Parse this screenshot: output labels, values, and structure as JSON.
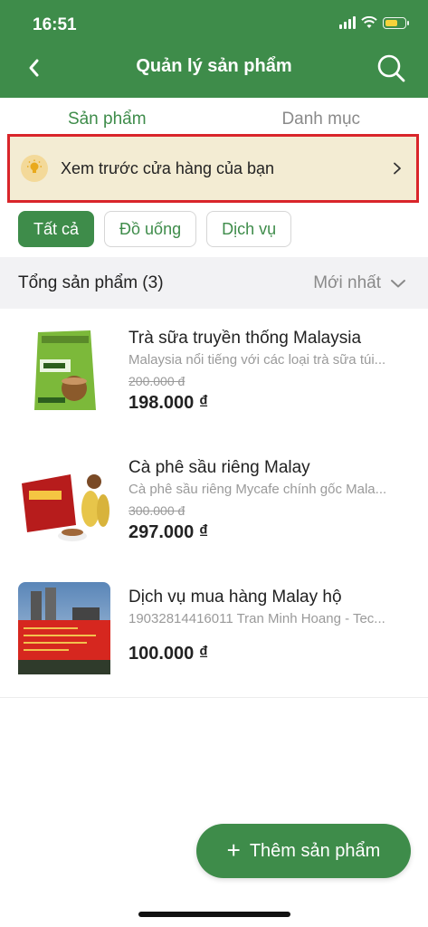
{
  "status_bar": {
    "time": "16:51"
  },
  "header": {
    "title": "Quản lý sản phẩm"
  },
  "tabs": [
    {
      "label": "Sản phẩm",
      "active": true
    },
    {
      "label": "Danh mục",
      "active": false
    }
  ],
  "preview_banner": {
    "text": "Xem trước cửa hàng của bạn"
  },
  "filters": [
    {
      "label": "Tất cả",
      "active": true
    },
    {
      "label": "Đồ uống",
      "active": false
    },
    {
      "label": "Dịch vụ",
      "active": false
    }
  ],
  "summary": {
    "total_label": "Tổng sản phẩm (3)",
    "sort_label": "Mới nhất"
  },
  "products": [
    {
      "name": "Trà sữa truyền thống Malaysia",
      "description": "Malaysia nổi tiếng với các loại trà sữa túi...",
      "old_price": "200.000 đ",
      "price": "198.000 ₫"
    },
    {
      "name": "Cà phê sầu riêng Malay",
      "description": "Cà phê sầu riêng Mycafe chính gốc Mala...",
      "old_price": "300.000 đ",
      "price": "297.000 ₫"
    },
    {
      "name": "Dịch vụ mua hàng Malay hộ",
      "description": "19032814416011 Tran Minh Hoang - Tec...",
      "old_price": "",
      "price": "100.000 ₫"
    }
  ],
  "add_button": {
    "label": "Thêm sản phẩm"
  },
  "colors": {
    "primary": "#3e8c4a",
    "highlight_border": "#d9252a",
    "banner_bg": "#f3ecd3"
  }
}
